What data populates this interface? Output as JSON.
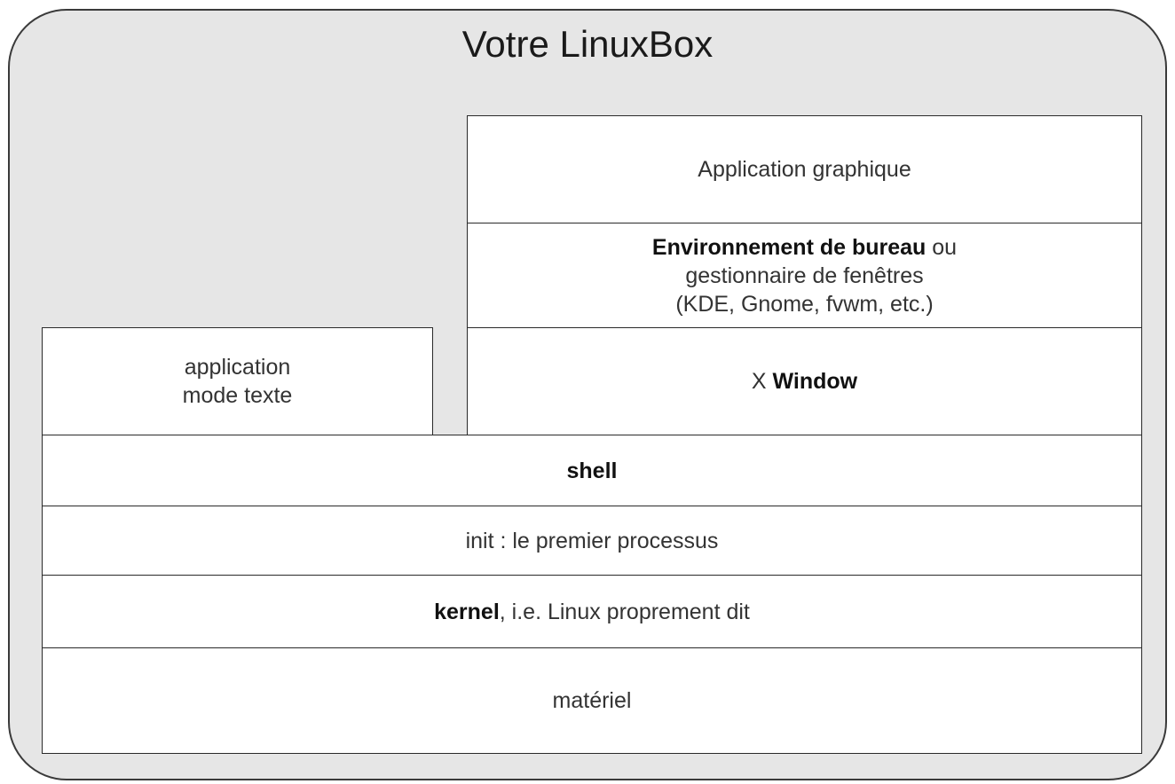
{
  "title": "Votre LinuxBox",
  "layers": {
    "app_graphique": "Application graphique",
    "desktop": {
      "bold": "Environnement de bureau",
      "rest": " ou",
      "line2": "gestionnaire de fenêtres",
      "line3": "(KDE, Gnome, fvwm, etc.)"
    },
    "app_texte": {
      "line1": "application",
      "line2": "mode texte"
    },
    "xwindow": {
      "prefix": "X ",
      "bold": "Window"
    },
    "shell": "shell",
    "init": "init : le premier processus",
    "kernel": {
      "bold": "kernel",
      "rest": ", i.e. Linux proprement dit"
    },
    "materiel": "matériel"
  }
}
